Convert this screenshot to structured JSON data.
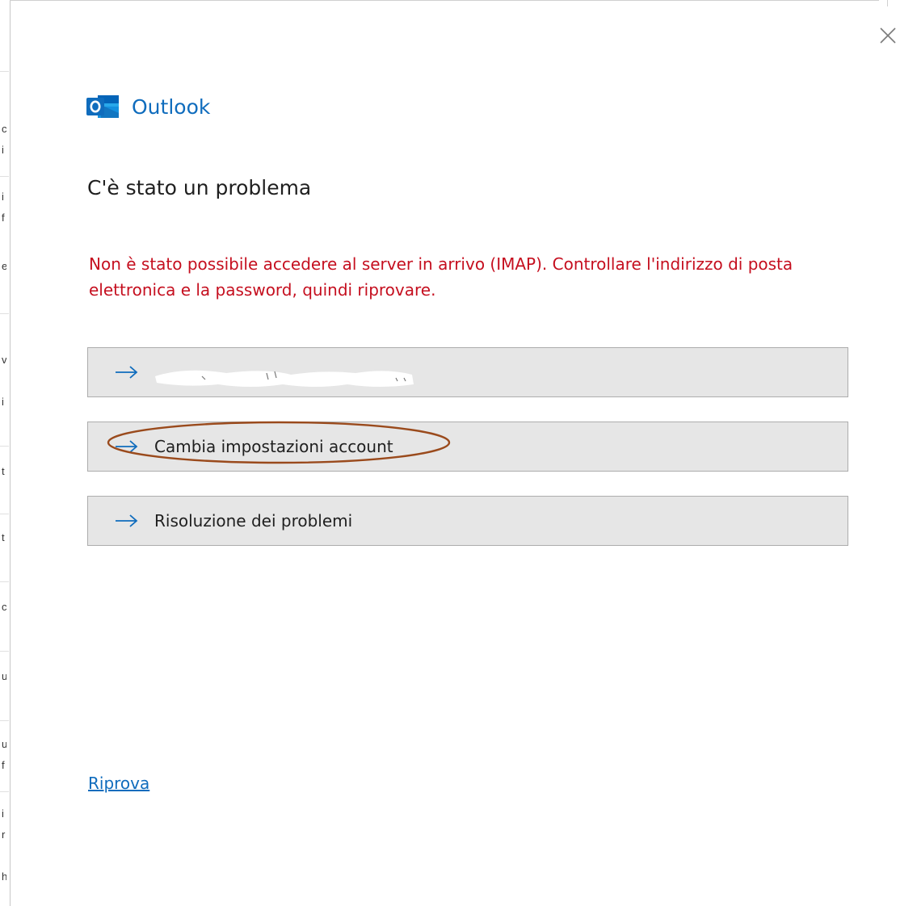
{
  "dialog": {
    "app_name": "Outlook",
    "heading": "C'è stato un problema",
    "error_message": "Non è stato possibile accedere al server in arrivo (IMAP). Controllare l'indirizzo di posta elettronica e la password, quindi riprovare.",
    "close_icon": "close-icon",
    "logo_icon": "outlook-logo-icon"
  },
  "actions": [
    {
      "label": "",
      "icon": "arrow-right-icon",
      "note_redacted": true
    },
    {
      "label": "Cambia impostazioni account",
      "icon": "arrow-right-icon"
    },
    {
      "label": "Risoluzione dei problemi",
      "icon": "arrow-right-icon"
    }
  ],
  "footer": {
    "retry_label": "Riprova"
  },
  "colors": {
    "accent": "#0f6cbd",
    "error": "#c50f1f",
    "button_bg": "#e6e6e6",
    "highlight": "#9a4a1c"
  }
}
